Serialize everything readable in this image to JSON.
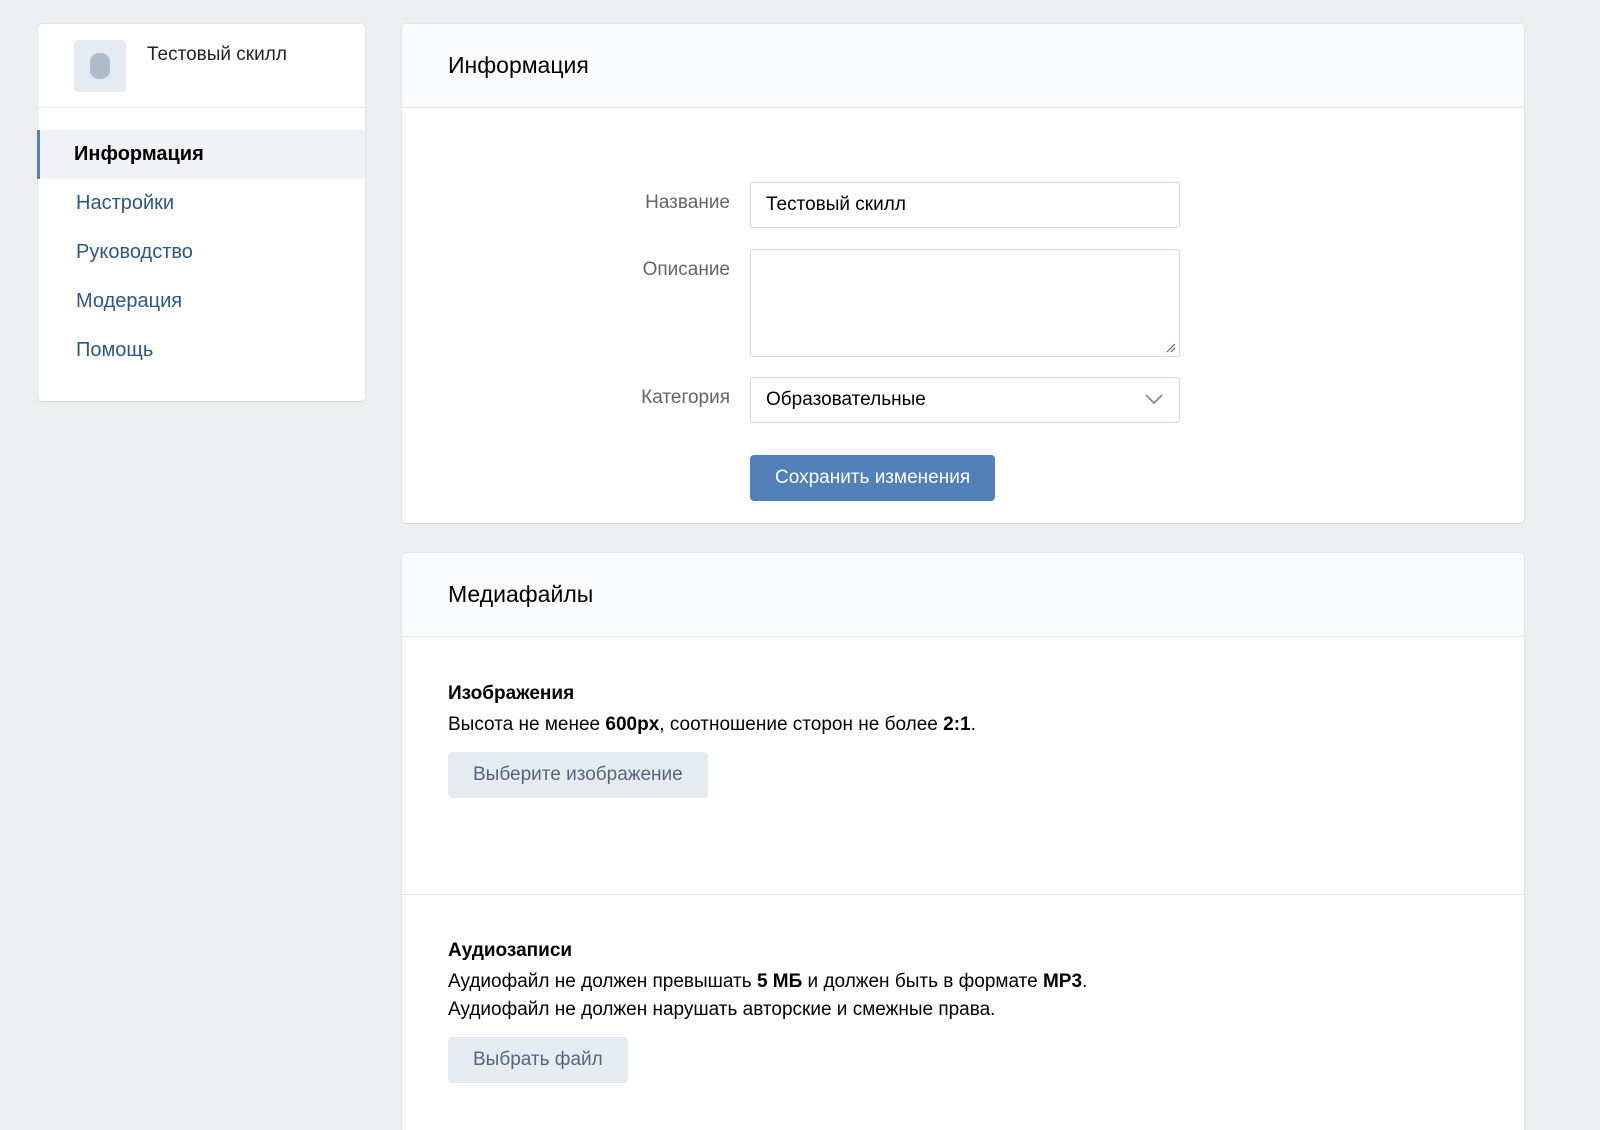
{
  "sidebar": {
    "app_name": "Тестовый скилл",
    "items": [
      {
        "label": "Информация",
        "active": true
      },
      {
        "label": "Настройки"
      },
      {
        "label": "Руководство"
      },
      {
        "label": "Модерация"
      },
      {
        "label": "Помощь"
      }
    ]
  },
  "info": {
    "title": "Информация",
    "name_label": "Название",
    "name_value": "Тестовый скилл",
    "description_label": "Описание",
    "description_value": "",
    "category_label": "Категория",
    "category_value": "Образовательные",
    "save_button": "Сохранить изменения"
  },
  "media": {
    "title": "Медиафайлы",
    "images": {
      "title": "Изображения",
      "text_1": "Высота не менее ",
      "text_bold_1": "600px",
      "text_2": ", соотношение сторон не более ",
      "text_bold_2": "2:1",
      "text_3": ".",
      "button": "Выберите изображение"
    },
    "audio": {
      "title": "Аудиозаписи",
      "line1_1": "Аудиофайл не должен превышать ",
      "line1_bold_1": "5 МБ",
      "line1_2": " и должен быть в формате ",
      "line1_bold_2": "MP3",
      "line1_3": ".",
      "line2": "Аудиофайл не должен нарушать авторские и смежные права.",
      "button": "Выбрать файл"
    }
  },
  "colors": {
    "accent": "#5181b8",
    "link": "#2a5885",
    "background": "#edeef0"
  }
}
